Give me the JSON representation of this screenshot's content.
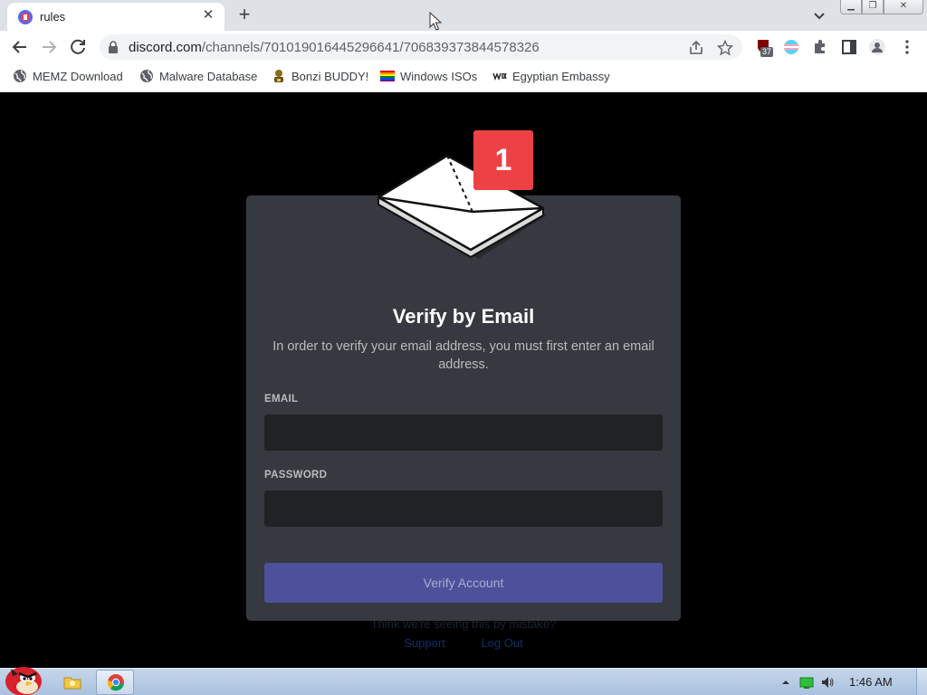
{
  "browser": {
    "tab": {
      "title": "rules",
      "close_glyph": "✕",
      "favicon": "discord-server-icon"
    },
    "new_tab_glyph": "+",
    "window_controls": {
      "minimize": "▁",
      "maximize": "❐",
      "close": "✕"
    },
    "url": {
      "host": "discord.com",
      "path": "/channels/701019016445296641/706839373844578326"
    },
    "extension_badge": "37",
    "bookmarks": [
      {
        "label": "MEMZ Download",
        "icon": "globe-icon"
      },
      {
        "label": "Malware Database",
        "icon": "globe-icon"
      },
      {
        "label": "Bonzi BUDDY!",
        "icon": "bonzi-icon"
      },
      {
        "label": "Windows ISOs",
        "icon": "rainbow-flag-icon"
      },
      {
        "label": "Egyptian Embassy",
        "icon": "wix-icon"
      }
    ]
  },
  "modal": {
    "notification_count": "1",
    "title": "Verify by Email",
    "description": "In order to verify your email address, you must first enter an email address.",
    "email_label": "EMAIL",
    "email_value": "",
    "password_label": "PASSWORD",
    "password_value": "",
    "submit_label": "Verify Account"
  },
  "background_page": {
    "text": "Think we're seeing this by mistake?",
    "links": [
      "Support",
      "Log Out"
    ]
  },
  "taskbar": {
    "clock": "1:46 AM"
  },
  "colors": {
    "modal_bg": "#36393f",
    "input_bg": "#202225",
    "button_bg": "#4e5199",
    "badge_red": "#ed4245"
  }
}
